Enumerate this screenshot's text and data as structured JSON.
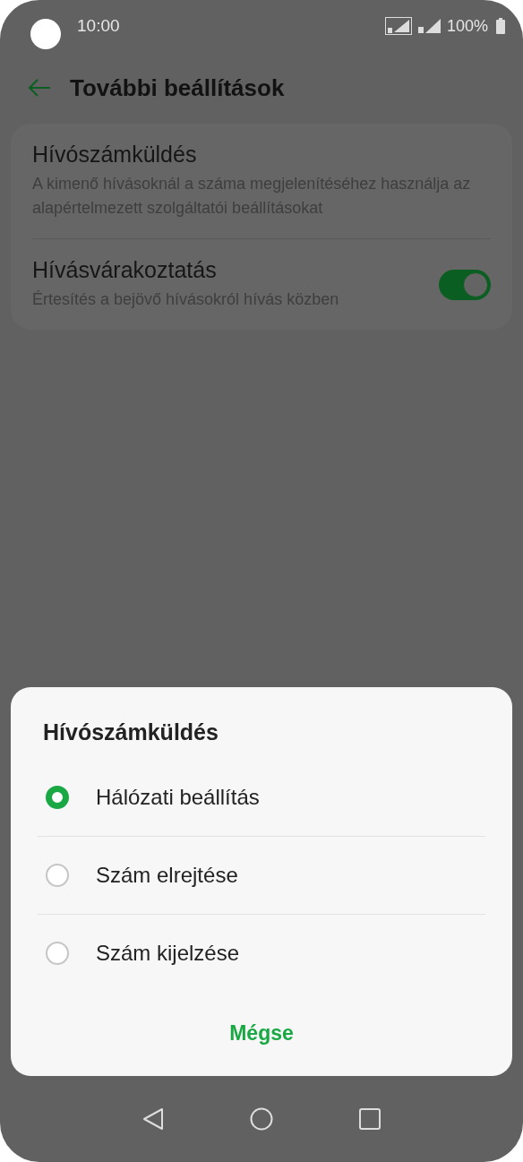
{
  "status_bar": {
    "time": "10:00",
    "battery": "100%"
  },
  "header": {
    "title": "További beállítások"
  },
  "settings": [
    {
      "kind": "text",
      "title": "Hívószámküldés",
      "subtitle": "A kimenő hívásoknál a száma megjelenítéséhez használja az alapértelmezett szolgáltatói beállításokat"
    },
    {
      "kind": "toggle",
      "title": "Hívásvárakoztatás",
      "subtitle": "Értesítés a bejövő hívásokról hívás közben",
      "on": true
    }
  ],
  "dialog": {
    "title": "Hívószámküldés",
    "options": [
      {
        "label": "Hálózati beállítás",
        "selected": true
      },
      {
        "label": "Szám elrejtése",
        "selected": false
      },
      {
        "label": "Szám kijelzése",
        "selected": false
      }
    ],
    "cancel": "Mégse"
  }
}
